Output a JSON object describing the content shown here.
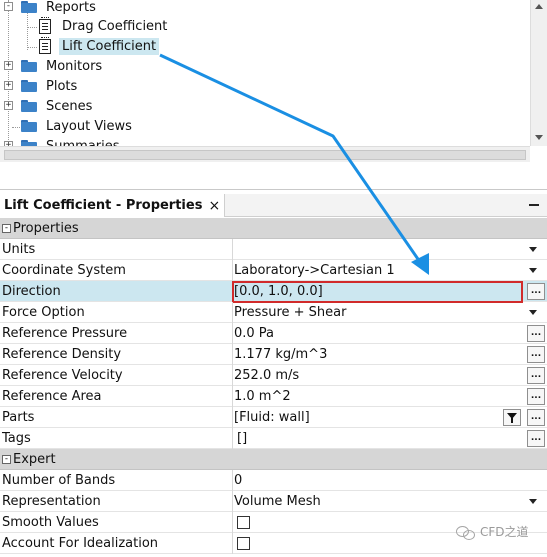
{
  "tree": {
    "items": [
      {
        "label": "Reports",
        "expander": "-"
      },
      {
        "label": "Drag Coefficient"
      },
      {
        "label": "Lift Coefficient",
        "selected": true
      },
      {
        "label": "Monitors",
        "expander": "+"
      },
      {
        "label": "Plots",
        "expander": "+"
      },
      {
        "label": "Scenes",
        "expander": "+"
      },
      {
        "label": "Layout Views"
      },
      {
        "label": "Summaries",
        "expander": "+"
      }
    ]
  },
  "properties_panel": {
    "tab_title": "Lift Coefficient - Properties",
    "close_glyph": "×",
    "sections": [
      {
        "title": "Properties",
        "toggle": "-",
        "rows": [
          {
            "name": "Units",
            "value": "",
            "control": "dropdown"
          },
          {
            "name": "Coordinate System",
            "value": "Laboratory->Cartesian 1",
            "control": "dropdown"
          },
          {
            "name": "Direction",
            "value": "[0.0, 1.0, 0.0]",
            "control": "ellipsis",
            "highlighted": true
          },
          {
            "name": "Force Option",
            "value": "Pressure + Shear",
            "control": "dropdown"
          },
          {
            "name": "Reference Pressure",
            "value": "0.0 Pa",
            "control": "ellipsis"
          },
          {
            "name": "Reference Density",
            "value": "1.177 kg/m^3",
            "control": "ellipsis"
          },
          {
            "name": "Reference Velocity",
            "value": "252.0 m/s",
            "control": "ellipsis"
          },
          {
            "name": "Reference Area",
            "value": "1.0 m^2",
            "control": "ellipsis"
          },
          {
            "name": "Parts",
            "value": "[Fluid: wall]",
            "control": "filter+ellipsis"
          },
          {
            "name": "Tags",
            "value": "[]",
            "control": "ellipsis"
          }
        ]
      },
      {
        "title": "Expert",
        "toggle": "-",
        "rows": [
          {
            "name": "Number of Bands",
            "value": "0",
            "control": "none"
          },
          {
            "name": "Representation",
            "value": "Volume Mesh",
            "control": "dropdown"
          },
          {
            "name": "Smooth Values",
            "value": "",
            "control": "checkbox",
            "checked": false
          },
          {
            "name": "Account For Idealization",
            "value": "",
            "control": "checkbox",
            "checked": false
          }
        ]
      }
    ],
    "ellipsis_label": "..."
  },
  "annotation": {
    "arrow_color": "#1a8fe3",
    "highlight_color": "#d12b2b"
  },
  "watermark": {
    "text": "CFD之道",
    "icon": "wechat-icon"
  }
}
